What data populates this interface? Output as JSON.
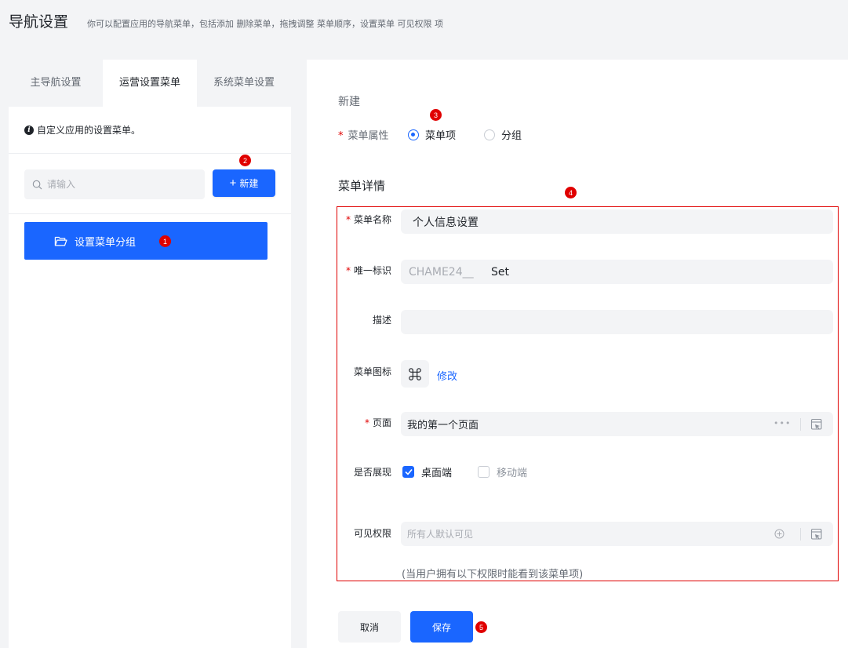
{
  "header": {
    "title": "导航设置",
    "description": "你可以配置应用的导航菜单，包括添加 删除菜单，拖拽调整 菜单顺序，设置菜单 可见权限 项"
  },
  "left": {
    "tabs": [
      {
        "label": "主导航设置",
        "active": false
      },
      {
        "label": "运营设置菜单",
        "active": true
      },
      {
        "label": "系统菜单设置",
        "active": false
      }
    ],
    "tip_icon": "info-icon",
    "tip": "自定义应用的设置菜单。",
    "search_placeholder": "请输入",
    "new_button": "新建",
    "group_item": "设置菜单分组"
  },
  "form": {
    "section_title": "新建",
    "menu_property_label": "菜单属性",
    "radio_options": [
      {
        "label": "菜单项",
        "checked": true
      },
      {
        "label": "分组",
        "checked": false
      }
    ],
    "detail_title": "菜单详情",
    "name_label": "菜单名称",
    "name_value": "个人信息设置",
    "id_label": "唯一标识",
    "id_prefix": "CHAME24__",
    "id_value": "Set",
    "desc_label": "描述",
    "desc_value": "",
    "icon_label": "菜单图标",
    "icon_name": "command-icon",
    "icon_modify": "修改",
    "page_label": "页面",
    "page_value": "我的第一个页面",
    "display_label": "是否展现",
    "display_options": [
      {
        "label": "桌面端",
        "checked": true
      },
      {
        "label": "移动端",
        "checked": false
      }
    ],
    "permission_label": "可见权限",
    "permission_placeholder": "所有人默认可见",
    "permission_help": "(当用户拥有以下权限时能看到该菜单项)"
  },
  "footer": {
    "cancel": "取消",
    "save": "保存"
  },
  "badges": [
    "1",
    "2",
    "3",
    "4",
    "5"
  ],
  "colors": {
    "primary": "#1a66ff",
    "annotation_red": "#e00000",
    "background": "#f3f4f6"
  }
}
